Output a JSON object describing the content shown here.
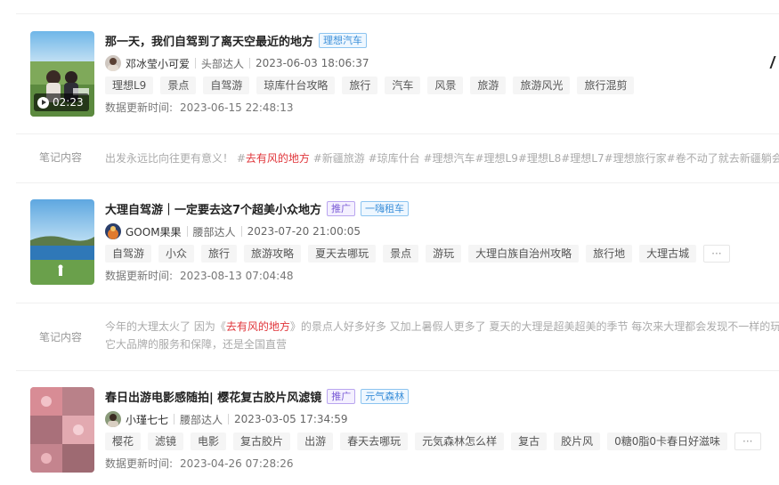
{
  "items": [
    {
      "title": "那一天，我们自驾到了离天空最近的地方",
      "tags": [
        {
          "type": "brand",
          "label": "理想汽车"
        }
      ],
      "duration": "02:23",
      "author": "邓冰莹小可爱",
      "level": "头部达人",
      "published": "2023-06-03 18:06:37",
      "chips": [
        "理想L9",
        "景点",
        "自驾游",
        "琼库什台攻略",
        "旅行",
        "汽车",
        "风景",
        "旅游",
        "旅游风光",
        "旅行混剪"
      ],
      "updated_label": "数据更新时间:",
      "updated": "2023-06-15 22:48:13",
      "note_label": "笔记内容",
      "note_prefix": "出发永远比向往更有意义！ #",
      "note_highlight": "去有风的地方",
      "note_suffix": " #新疆旅游 #琼库什台 #理想汽车#理想L9#理想L8#理想L7#理想旅行家#卷不动了就去新疆躺会#自"
    },
    {
      "title": "大理自驾游｜一定要去这7个超美小众地方",
      "tags": [
        {
          "type": "ad",
          "label": "推广"
        },
        {
          "type": "brand",
          "label": "一嗨租车"
        }
      ],
      "author": "GOOM果果",
      "level": "腰部达人",
      "published": "2023-07-20 21:00:05",
      "chips": [
        "自驾游",
        "小众",
        "旅行",
        "旅游攻略",
        "夏天去哪玩",
        "景点",
        "游玩",
        "大理白族自治州攻略",
        "旅行地",
        "大理古城"
      ],
      "more": "···",
      "updated_label": "数据更新时间:",
      "updated": "2023-08-13 07:04:48",
      "note_label": "笔记内容",
      "note_prefix": "今年的大理太火了 因为《",
      "note_highlight": "去有风的地方",
      "note_suffix": "》的景点人好多好多 又加上暑假人更多了 夏天的大理是超美超美的季节 每次来大理都会发现不一样的玩",
      "note_line2": "它大品牌的服务和保障，还是全国直营"
    },
    {
      "title": "春日出游电影感随拍| 樱花复古胶片风滤镜",
      "tags": [
        {
          "type": "ad",
          "label": "推广"
        },
        {
          "type": "brand",
          "label": "元气森林"
        }
      ],
      "author": "小瑾七七",
      "level": "腰部达人",
      "published": "2023-03-05 17:34:59",
      "chips": [
        "樱花",
        "滤镜",
        "电影",
        "复古胶片",
        "出游",
        "春天去哪玩",
        "元気森林怎么样",
        "复古",
        "胶片风",
        "0糖0脂0卡春日好滋味"
      ],
      "more": "···",
      "updated_label": "数据更新时间:",
      "updated": "2023-04-26 07:28:26"
    }
  ]
}
